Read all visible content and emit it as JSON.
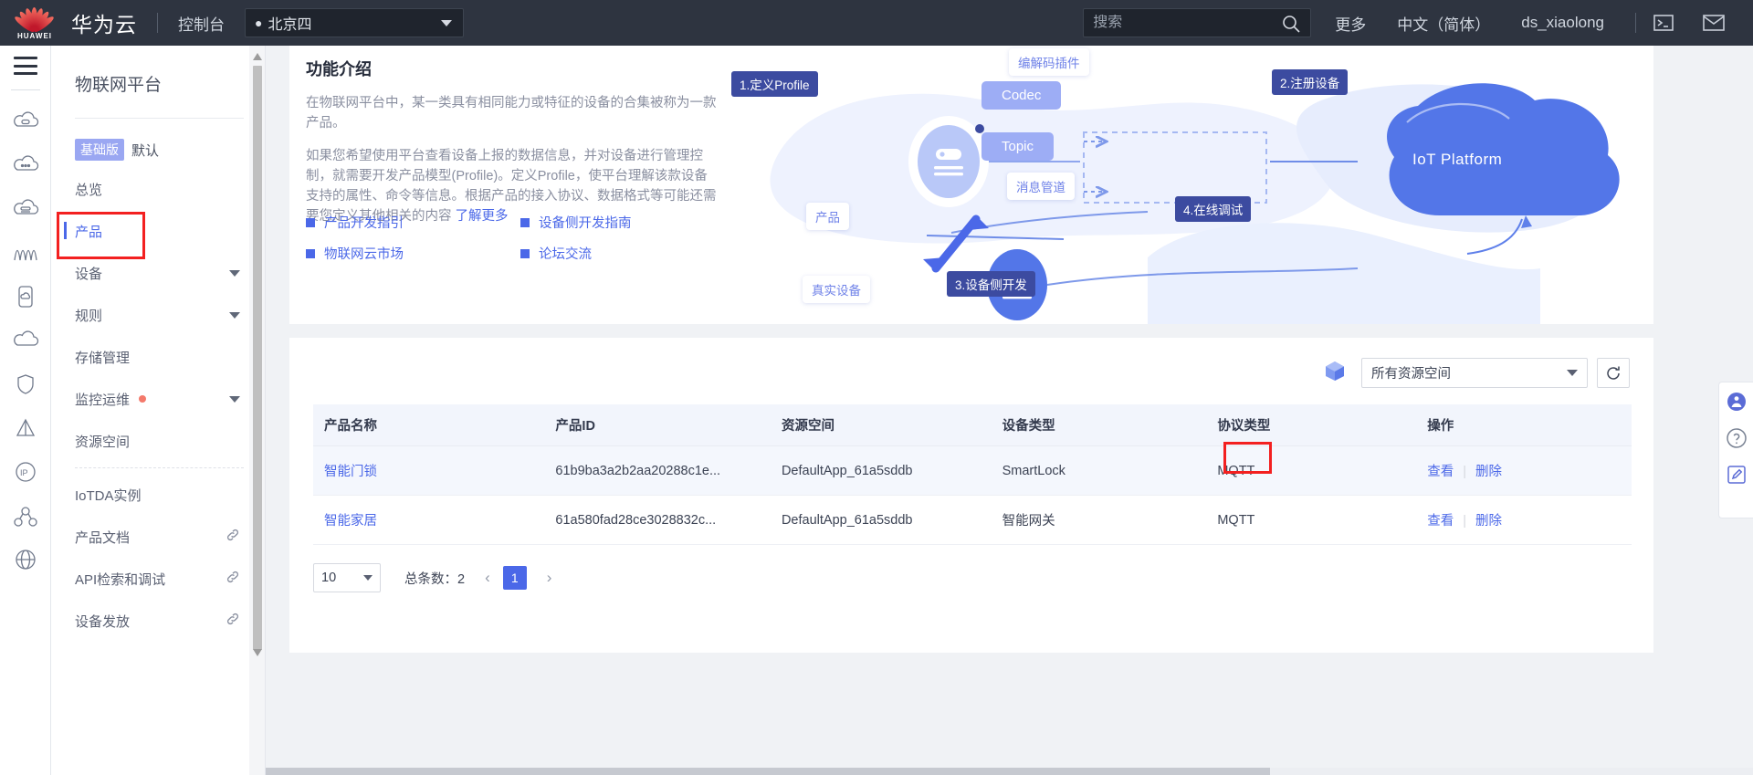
{
  "header": {
    "brand": "华为云",
    "logo_word": "HUAWEI",
    "console": "控制台",
    "region": "北京四",
    "search_placeholder": "搜索",
    "more": "更多",
    "language": "中文（简体）",
    "user": "ds_xiaolong",
    "icons": {
      "search": "search-icon",
      "terminal": "terminal-icon",
      "mail": "mail-icon"
    }
  },
  "rail": {
    "icons": [
      "menu-icon",
      "cloud-server-icon",
      "cloud-dots-icon",
      "cloud-storage-icon",
      "wave-icon",
      "device-icon",
      "cloud-icon",
      "shield-icon",
      "triangle-icon",
      "ip-icon",
      "network-icon",
      "globe-icon"
    ]
  },
  "sidebar": {
    "title": "物联网平台",
    "edition_badge": "基础版",
    "edition_name": "默认",
    "items": [
      {
        "label": "总览",
        "active": false,
        "arrow": false,
        "dot": false,
        "link": false
      },
      {
        "label": "产品",
        "active": true,
        "arrow": false,
        "dot": false,
        "link": false
      },
      {
        "label": "设备",
        "active": false,
        "arrow": true,
        "dot": false,
        "link": false
      },
      {
        "label": "规则",
        "active": false,
        "arrow": true,
        "dot": false,
        "link": false
      },
      {
        "label": "存储管理",
        "active": false,
        "arrow": false,
        "dot": false,
        "link": false
      },
      {
        "label": "监控运维",
        "active": false,
        "arrow": true,
        "dot": true,
        "link": false
      },
      {
        "label": "资源空间",
        "active": false,
        "arrow": false,
        "dot": false,
        "link": false
      }
    ],
    "items2": [
      {
        "label": "IoTDA实例",
        "link": false
      },
      {
        "label": "产品文档",
        "link": true
      },
      {
        "label": "API检索和调试",
        "link": true
      },
      {
        "label": "设备发放",
        "link": true
      }
    ]
  },
  "intro": {
    "title": "功能介绍",
    "p1": "在物联网平台中，某一类具有相同能力或特征的设备的合集被称为一款产品。",
    "p2": "如果您希望使用平台查看设备上报的数据信息，并对设备进行管理控制，就需要开发产品模型(Profile)。定义Profile，使平台理解该款设备支持的属性、命令等信息。根据产品的接入协议、数据格式等可能还需要您定义其他相关的内容",
    "more_link": "了解更多",
    "links": [
      "产品开发指引",
      "设备侧开发指南",
      "物联网云市场",
      "论坛交流"
    ]
  },
  "diagram": {
    "step1": "1.定义Profile",
    "step2": "2.注册设备",
    "step3": "3.设备侧开发",
    "step4": "4.在线调试",
    "codec_label": "编解码插件",
    "codec": "Codec",
    "topic": "Topic",
    "channel_label": "消息管道",
    "product_label": "产品",
    "real_device_label": "真实设备",
    "platform_label": "IoT Platform"
  },
  "table": {
    "space_filter": "所有资源空间",
    "refresh_icon": "refresh-icon",
    "cube_icon": "cube-icon",
    "columns": [
      "产品名称",
      "产品ID",
      "资源空间",
      "设备类型",
      "协议类型",
      "操作"
    ],
    "rows": [
      {
        "name": "智能门锁",
        "id": "61b9ba3a2b2aa20288c1e...",
        "space": "DefaultApp_61a5sddb",
        "device_type": "SmartLock",
        "protocol": "MQTT",
        "action_view": "查看",
        "action_delete": "删除",
        "highlight": true
      },
      {
        "name": "智能家居",
        "id": "61a580fad28ce3028832c...",
        "space": "DefaultApp_61a5sddb",
        "device_type": "智能网关",
        "protocol": "MQTT",
        "action_view": "查看",
        "action_delete": "删除",
        "highlight": false
      }
    ],
    "pagination": {
      "page_size": "10",
      "total_label": "总条数：",
      "total": "2",
      "current_page": "1",
      "prev": "‹",
      "next": "›"
    }
  },
  "floatbar": {
    "icons": [
      "support-icon",
      "help-icon",
      "feedback-icon"
    ]
  },
  "colors": {
    "accent": "#4b68e8",
    "header_bg": "#2e3440",
    "highlight_box": "#f32020",
    "badge": "#9aa7f2"
  }
}
